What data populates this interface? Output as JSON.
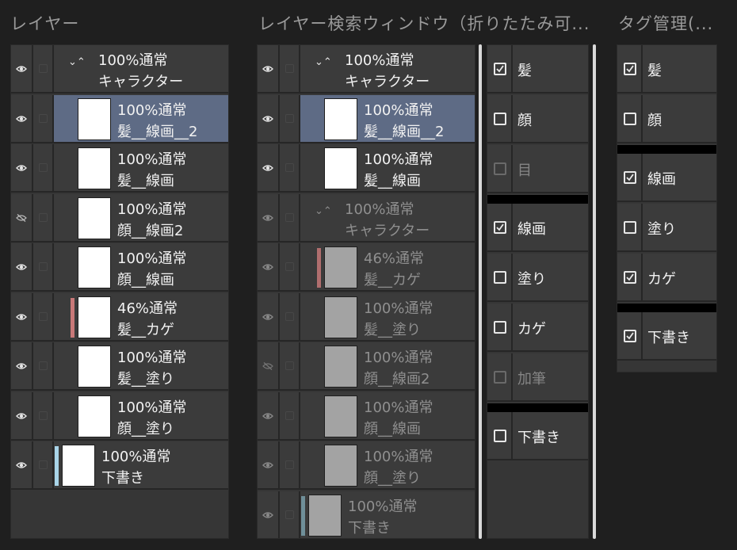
{
  "titles": {
    "layer": "レイヤー",
    "search": "レイヤー検索ウィンドウ（折りたたみ可...",
    "tags": "タグ管理(..."
  },
  "layers": [
    {
      "line1": "100%通常",
      "line2": "キャラクター",
      "folder": true,
      "visible": true
    },
    {
      "line1": "100%通常",
      "line2": "髪__線画__2",
      "visible": true,
      "selected": true
    },
    {
      "line1": "100%通常",
      "line2": "髪__線画",
      "visible": true
    },
    {
      "line1": "100%通常",
      "line2": "顔__線画2",
      "visible": false
    },
    {
      "line1": "100%通常",
      "line2": "顔__線画",
      "visible": true
    },
    {
      "line1": "46%通常",
      "line2": "髪__カゲ",
      "visible": true,
      "color": "#c87878"
    },
    {
      "line1": "100%通常",
      "line2": "髪__塗り",
      "visible": true
    },
    {
      "line1": "100%通常",
      "line2": "顔__塗り",
      "visible": true
    },
    {
      "line1": "100%通常",
      "line2": "下書き",
      "visible": true,
      "color": "#a8d4e8"
    }
  ],
  "search_layers": [
    {
      "line1": "100%通常",
      "line2": "キャラクター",
      "folder": true,
      "visible": true
    },
    {
      "line1": "100%通常",
      "line2": "髪__線画__2",
      "visible": true,
      "selected": true
    },
    {
      "line1": "100%通常",
      "line2": "髪__線画",
      "visible": true
    },
    {
      "line1": "100%通常",
      "line2": "キャラクター",
      "folder": true,
      "visible": true,
      "dim": true
    },
    {
      "line1": "46%通常",
      "line2": "髪__カゲ",
      "visible": true,
      "dim": true,
      "color": "#b06e6e"
    },
    {
      "line1": "100%通常",
      "line2": "髪__塗り",
      "visible": true,
      "dim": true
    },
    {
      "line1": "100%通常",
      "line2": "顔__線画2",
      "visible": false,
      "dim": true
    },
    {
      "line1": "100%通常",
      "line2": "顔__線画",
      "visible": true,
      "dim": true
    },
    {
      "line1": "100%通常",
      "line2": "顔__塗り",
      "visible": true,
      "dim": true
    },
    {
      "line1": "100%通常",
      "line2": "下書き",
      "visible": true,
      "dim": true,
      "color": "#6f8f99"
    }
  ],
  "search_tags": [
    {
      "label": "髪",
      "checked": true
    },
    {
      "label": "顔",
      "checked": false
    },
    {
      "label": "目",
      "checked": false,
      "dim": true
    },
    {
      "separator": true
    },
    {
      "label": "線画",
      "checked": true
    },
    {
      "label": "塗り",
      "checked": false
    },
    {
      "label": "カゲ",
      "checked": false
    },
    {
      "label": "加筆",
      "checked": false,
      "dim": true
    },
    {
      "separator": true
    },
    {
      "label": "下書き",
      "checked": false
    }
  ],
  "tag_manager": [
    {
      "label": "髪",
      "checked": true
    },
    {
      "label": "顔",
      "checked": false
    },
    {
      "separator": true
    },
    {
      "label": "線画",
      "checked": true
    },
    {
      "label": "塗り",
      "checked": false
    },
    {
      "label": "カゲ",
      "checked": true
    },
    {
      "separator": true
    },
    {
      "label": "下書き",
      "checked": true
    }
  ],
  "icons": {
    "visible": "eye-icon",
    "hidden": "eye-off-icon",
    "lock": "lock-icon",
    "folder": "chevron-folder-icon",
    "check": "check-icon"
  },
  "colors": {
    "selection": "#5e6b85",
    "background": "#1f1f1f",
    "row": "#3b3b3b"
  }
}
